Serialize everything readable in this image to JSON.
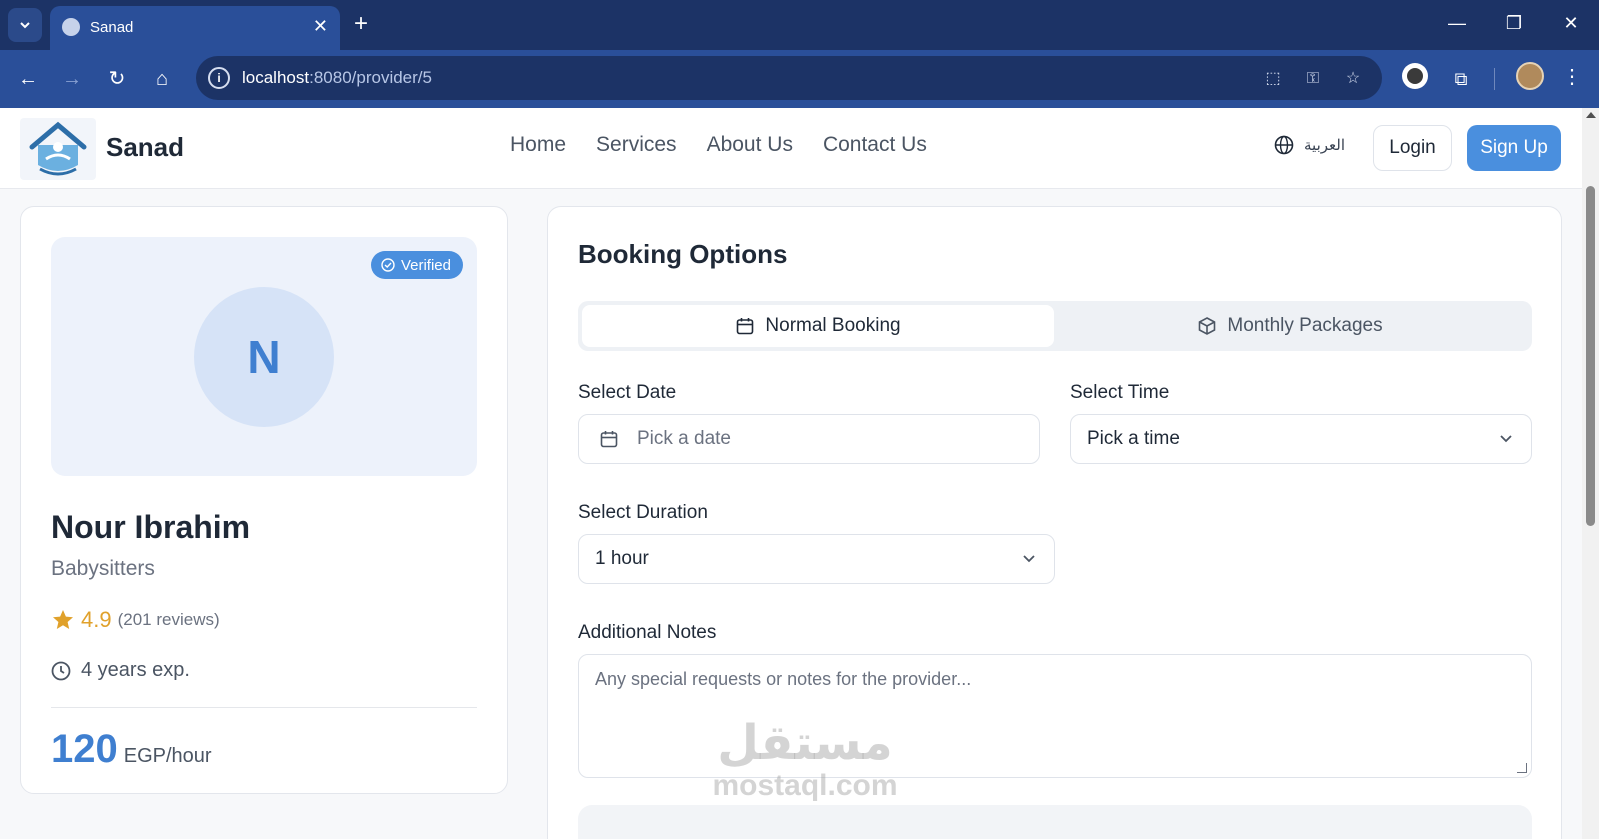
{
  "browser": {
    "tab_title": "Sanad",
    "url_host": "localhost",
    "url_rest": ":8080/provider/5"
  },
  "header": {
    "brand": "Sanad",
    "nav": [
      "Home",
      "Services",
      "About Us",
      "Contact Us"
    ],
    "language": "العربية",
    "login": "Login",
    "signup": "Sign Up"
  },
  "profile": {
    "initial": "N",
    "verified": "Verified",
    "name": "Nour Ibrahim",
    "category": "Babysitters",
    "rating": "4.9",
    "reviews": "(201 reviews)",
    "experience": "4 years exp.",
    "price": "120",
    "price_unit": "EGP/hour"
  },
  "booking": {
    "title": "Booking Options",
    "tabs": [
      "Normal Booking",
      "Monthly Packages"
    ],
    "date_label": "Select Date",
    "date_placeholder": "Pick a date",
    "time_label": "Select Time",
    "time_placeholder": "Pick a time",
    "duration_label": "Select Duration",
    "duration_value": "1 hour",
    "notes_label": "Additional Notes",
    "notes_placeholder": "Any special requests or notes for the provider..."
  },
  "watermark": {
    "arabic": "مستقل",
    "latin": "mostaql.com"
  },
  "colors": {
    "accent": "#4a8fde",
    "browser_dark": "#1c3366",
    "browser_toolbar": "#2a4f99",
    "star": "#e0a12b"
  },
  "icons": [
    "chevron-down-icon",
    "globe-icon",
    "close-icon",
    "plus-icon",
    "back-arrow-icon",
    "forward-arrow-icon",
    "reload-icon",
    "home-icon",
    "info-icon",
    "translate-icon",
    "key-icon",
    "star-icon",
    "extensions-icon",
    "calendar-icon",
    "package-icon",
    "check-circle-icon",
    "clock-icon"
  ]
}
